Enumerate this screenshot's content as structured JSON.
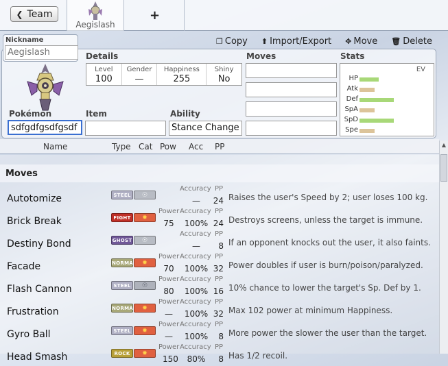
{
  "topbar": {
    "team_label": "Team",
    "tab_label": "Aegislash",
    "add_label": "+"
  },
  "nickname": {
    "label": "Nickname",
    "placeholder": "Aegislash",
    "value": ""
  },
  "actions": {
    "copy": "Copy",
    "import_export": "Import/Export",
    "move": "Move",
    "delete": "Delete"
  },
  "details": {
    "header": "Details",
    "level_label": "Level",
    "level": "100",
    "gender_label": "Gender",
    "gender": "—",
    "happiness_label": "Happiness",
    "happiness": "255",
    "shiny_label": "Shiny",
    "shiny": "No"
  },
  "pokemon": {
    "label": "Pokémon",
    "value": "sdfgdfgsdfgsdf"
  },
  "item": {
    "label": "Item",
    "value": ""
  },
  "ability": {
    "label": "Ability",
    "value": "Stance Change"
  },
  "moves_header": "Moves",
  "move_slots": [
    "",
    "",
    "",
    ""
  ],
  "stats": {
    "header": "Stats",
    "ev_label": "EV",
    "rows": [
      {
        "name": "HP",
        "fraction": 0.45,
        "color": "#a8d878"
      },
      {
        "name": "Atk",
        "fraction": 0.35,
        "color": "#dcc49a"
      },
      {
        "name": "Def",
        "fraction": 0.8,
        "color": "#a8d878"
      },
      {
        "name": "SpA",
        "fraction": 0.35,
        "color": "#dcc49a"
      },
      {
        "name": "SpD",
        "fraction": 0.8,
        "color": "#a8d878"
      },
      {
        "name": "Spe",
        "fraction": 0.35,
        "color": "#dcc49a"
      }
    ]
  },
  "columns": {
    "name": "Name",
    "type": "Type",
    "cat": "Cat",
    "pow": "Pow",
    "acc": "Acc",
    "pp": "PP"
  },
  "list": {
    "section": "Moves",
    "power_label": "Power",
    "accuracy_label": "Accuracy",
    "pp_label": "PP",
    "moves": [
      {
        "name": "Autotomize",
        "type": "STEEL",
        "type_color": "#b0b0c4",
        "category": "status",
        "power": "",
        "accuracy": "—",
        "pp": "24",
        "desc": "Raises the user's Speed by 2; user loses 100 kg."
      },
      {
        "name": "Brick Break",
        "type": "FIGHT",
        "type_color": "#c03028",
        "category": "physical",
        "power": "75",
        "accuracy": "100%",
        "pp": "24",
        "desc": "Destroys screens, unless the target is immune."
      },
      {
        "name": "Destiny Bond",
        "type": "GHOST",
        "type_color": "#705898",
        "category": "status",
        "power": "",
        "accuracy": "—",
        "pp": "8",
        "desc": "If an opponent knocks out the user, it also faints."
      },
      {
        "name": "Facade",
        "type": "NORMAL",
        "type_color": "#a8a878",
        "category": "physical",
        "power": "70",
        "accuracy": "100%",
        "pp": "32",
        "desc": "Power doubles if user is burn/poison/paralyzed."
      },
      {
        "name": "Flash Cannon",
        "type": "STEEL",
        "type_color": "#b0b0c4",
        "category": "special",
        "power": "80",
        "accuracy": "100%",
        "pp": "16",
        "desc": "10% chance to lower the target's Sp. Def by 1."
      },
      {
        "name": "Frustration",
        "type": "NORMAL",
        "type_color": "#a8a878",
        "category": "physical",
        "power": "—",
        "accuracy": "100%",
        "pp": "32",
        "desc": "Max 102 power at minimum Happiness."
      },
      {
        "name": "Gyro Ball",
        "type": "STEEL",
        "type_color": "#b0b0c4",
        "category": "physical",
        "power": "—",
        "accuracy": "100%",
        "pp": "8",
        "desc": "More power the slower the user than the target."
      },
      {
        "name": "Head Smash",
        "type": "ROCK",
        "type_color": "#b8a038",
        "category": "physical",
        "power": "150",
        "accuracy": "80%",
        "pp": "8",
        "desc": "Has 1/2 recoil."
      }
    ]
  }
}
